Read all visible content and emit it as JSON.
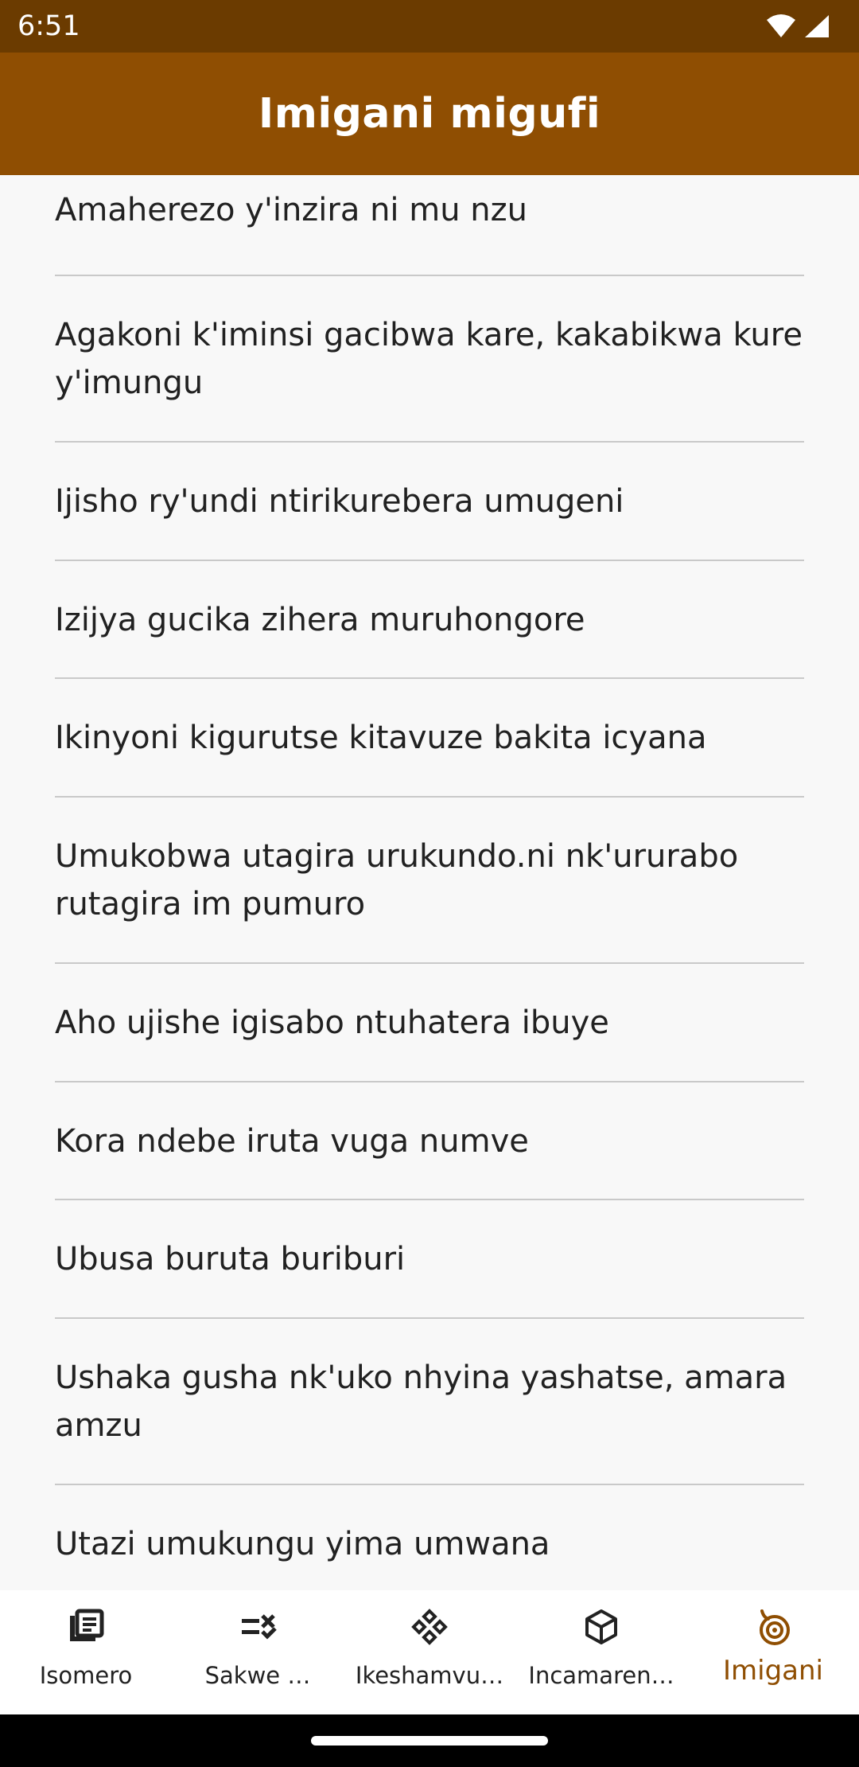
{
  "status_bar": {
    "time": "6:51",
    "icons": [
      "wifi-icon",
      "cell-signal-icon"
    ]
  },
  "app_bar": {
    "title": "Imigani migufi",
    "color": "#8f4e02"
  },
  "list": {
    "items": [
      "Amaherezo y'inzira ni mu nzu",
      "Agakoni k'iminsi gacibwa kare, kakabikwa kure y'imungu",
      "Ijisho ry'undi ntirikurebera umugeni",
      "Izijya gucika zihera muruhongore",
      "Ikinyoni kigurutse kitavuze bakita icyana",
      "Umukobwa utagira urukundo.ni nk'ururabo rutagira im pumuro",
      "Aho ujishe igisabo ntuhatera ibuye",
      "Kora ndebe iruta vuga numve",
      "Ubusa buruta buriburi",
      "Ushaka gusha nk'uko nhyina yashatse, amara amzu",
      "Utazi umukungu yima umwana"
    ]
  },
  "bottom_nav": {
    "items": [
      {
        "label": "Isomero",
        "icon": "library-icon",
        "active": false
      },
      {
        "label": "Sakwe …",
        "icon": "quiz-icon",
        "active": false
      },
      {
        "label": "Ikeshamvu…",
        "icon": "game-icon",
        "active": false
      },
      {
        "label": "Incamaren…",
        "icon": "box-icon",
        "active": false
      },
      {
        "label": "Imigani",
        "icon": "spiral-icon",
        "active": true
      }
    ],
    "active_color": "#8f4e02"
  }
}
